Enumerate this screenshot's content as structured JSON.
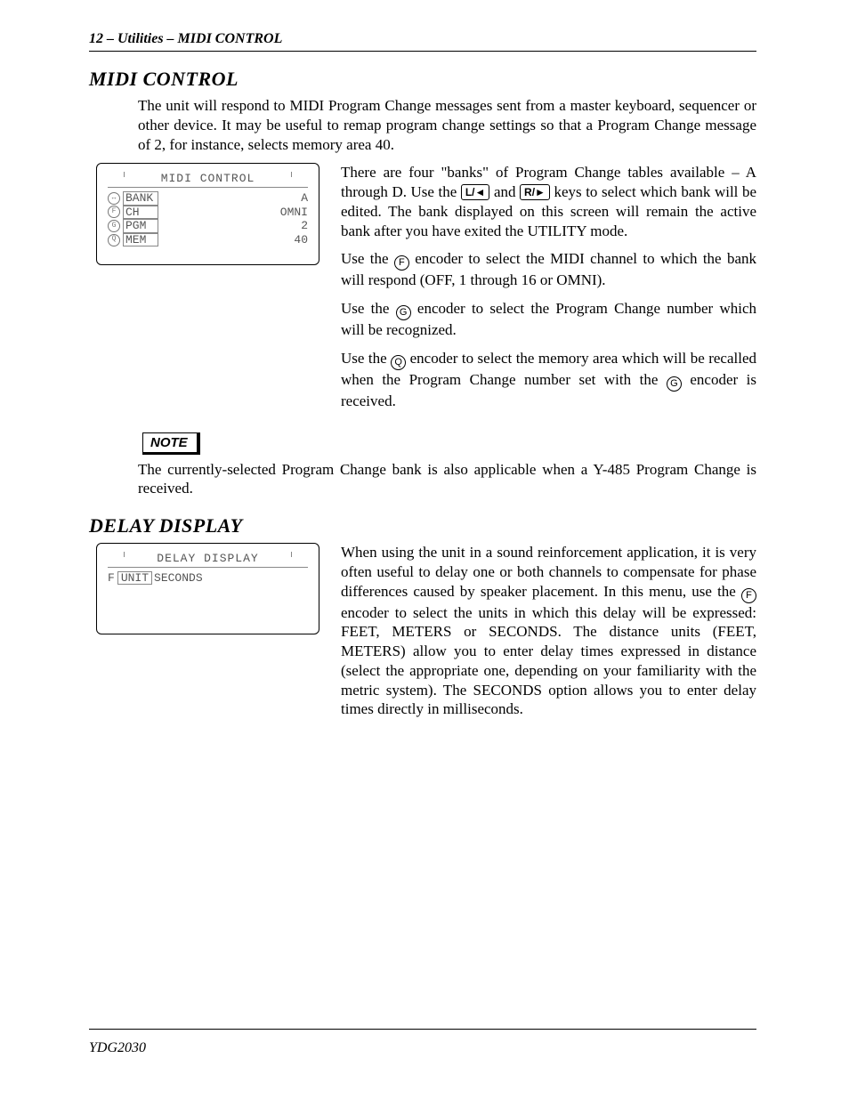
{
  "header": {
    "page_number": "12",
    "breadcrumb": " – Utilities – MIDI CONTROL"
  },
  "section1": {
    "title": "MIDI CONTROL",
    "intro": "The unit will respond to MIDI Program Change messages sent from a master keyboard, sequencer or other device. It may be useful to remap program change settings so that a Program Change message of 2, for instance, selects memory area 40.",
    "lcd": {
      "title": "MIDI CONTROL",
      "rows": [
        {
          "knob": "↔",
          "label": "BANK",
          "value": "A"
        },
        {
          "knob": "F",
          "label": "CH",
          "value": "OMNI"
        },
        {
          "knob": "G",
          "label": "PGM",
          "value": "2"
        },
        {
          "knob": "Q",
          "label": "MEM",
          "value": "40"
        }
      ]
    },
    "para_a_pre": "There are four \"banks\" of Program Change tables available – A through D. Use the ",
    "key_left": "L/◄",
    "para_a_mid": " and ",
    "key_right": "R/►",
    "para_a_post": " keys to select which bank will be edited. The bank displayed on this screen will remain the active bank after you have exited the UTILITY mode.",
    "para_b_pre": "Use the ",
    "enc_f": "F",
    "para_b_post": " encoder to select the MIDI channel to which the bank will respond (OFF, 1 through 16 or OMNI).",
    "para_c_pre": "Use the ",
    "enc_g": "G",
    "para_c_post": " encoder to select the Program Change number which will be recognized.",
    "para_d_pre": "Use the ",
    "enc_q": "Q",
    "para_d_mid": " encoder to select the memory area which will be recalled when the Program Change number set with the ",
    "enc_g2": "G",
    "para_d_post": " encoder is received.",
    "note_label": "NOTE",
    "note_text": "The currently-selected Program Change bank is also applicable when a Y-485 Program Change is received."
  },
  "section2": {
    "title": "DELAY DISPLAY",
    "lcd": {
      "title": "DELAY DISPLAY",
      "knob": "F",
      "label": "UNIT",
      "value": "SECONDS"
    },
    "para_pre": "When using the unit in a sound reinforcement application, it is very often useful to delay one or both channels to compensate for phase differences caused by speaker placement. In this menu, use the ",
    "enc_f": "F",
    "para_post": " encoder to select the units in which this delay will be expressed: FEET, METERS or SECONDS. The distance units (FEET, METERS) allow you to enter delay times expressed in distance (select the appropriate one, depending on your familiarity with the metric system). The SECONDS option allows you to enter delay times directly in milliseconds."
  },
  "footer": {
    "model": "YDG2030"
  }
}
